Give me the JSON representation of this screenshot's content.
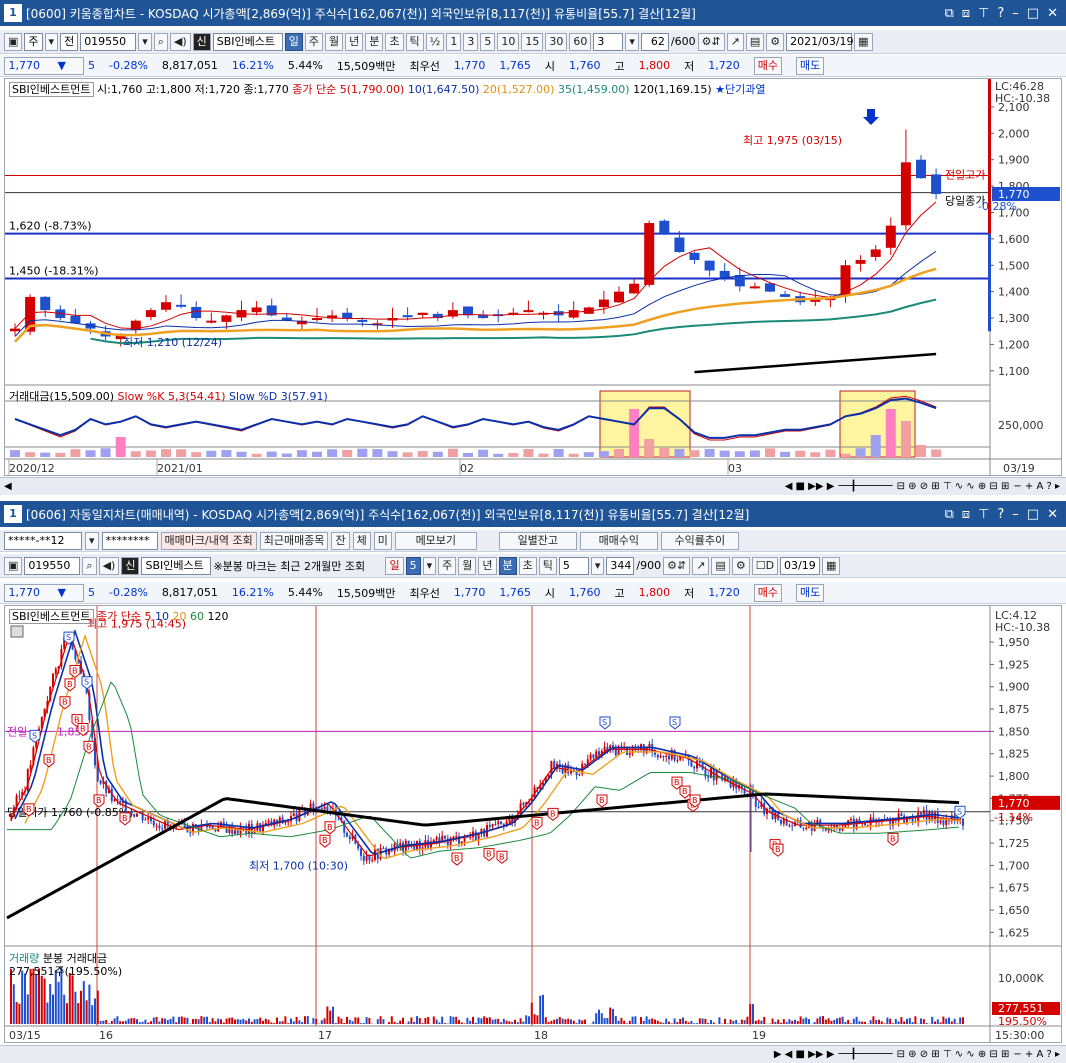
{
  "top": {
    "title_num": "1",
    "title": "[0600] 키움종합차트 - KOSDAQ 시가총액[2,869(억)] 주식수[162,067(천)] 외국인보유[8,117(천)] 유통비율[55.7] 결산[12월]",
    "toolbar": {
      "type_sel": "주",
      "type2": "전",
      "code": "019550",
      "name_badge": "신",
      "name": "SBI인베스트",
      "periods": [
        "일",
        "주",
        "월",
        "년",
        "분",
        "초",
        "틱"
      ],
      "active_period": "일",
      "frac": "½",
      "mins": [
        "1",
        "3",
        "5",
        "10",
        "15",
        "30",
        "60"
      ],
      "min_val": "3",
      "count": "62",
      "count_total": "/600",
      "date": "2021/03/19"
    },
    "quote": {
      "price": "1,770",
      "arrow": "▼",
      "change": "5",
      "pct": "-0.28%",
      "volume": "8,817,051",
      "vol_pct": "16.21%",
      "turnover": "5.44%",
      "amount": "15,509백만",
      "best_ask_label": "최우선",
      "ask": "1,770",
      "bid": "1,765",
      "open_label": "시",
      "open": "1,760",
      "high_label": "고",
      "high": "1,800",
      "low_label": "저",
      "low": "1,720",
      "buy": "매수",
      "sell": "매도"
    },
    "price_legend": {
      "name": "SBI인베스트먼트",
      "ohlc": "시:1,760 고:1,800 저:1,720 종:1,770",
      "ma_label": "종가 단순",
      "ma5": "5(1,790.00)",
      "ma10": "10(1,647.50)",
      "ma20": "20(1,527.00)",
      "ma35": "35(1,459.00)",
      "ma120": "120(1,169.15)",
      "star": "★단기과열"
    },
    "lc": "LC:46.28",
    "hc": "HC:-10.38",
    "price_ticks": [
      "2,100",
      "2,000",
      "1,900",
      "1,800",
      "1,700",
      "1,600",
      "1,500",
      "1,400",
      "1,300",
      "1,200",
      "1,100"
    ],
    "current_price_tag": "1,770",
    "current_pct_tag": "-0.28%",
    "hline1": "1,620 (-8.73%)",
    "hline2": "1,450 (-18.31%)",
    "max_label": "최고 1,975 (03/15)",
    "min_label": "최저 1,210 (12/24)",
    "prev_high": "전일고가",
    "today_close": "당일종가",
    "ind_legend": {
      "a": "거래대금(15,509.00)",
      "b": "Slow %K 5,3(54.41)",
      "c": "Slow %D 3(57.91)"
    },
    "ind_tick": "250,000",
    "xlabels": [
      "2020/12",
      "2021/01",
      "02",
      "03"
    ],
    "xlabel_right": "03/19"
  },
  "bottom": {
    "title_num": "1",
    "title": "[0606] 자동일지차트(매매내역) - KOSDAQ 시가총액[2,869(억)] 주식수[162,067(천)] 외국인보유[8,117(천)] 유통비율[55.7] 결산[12월]",
    "toolbar1": {
      "account": "*****-**12",
      "password": "********",
      "b1": "매매마크/내역 조회",
      "b2": "최근매매종목",
      "b3": "잔",
      "b4": "체",
      "b5": "미",
      "b6": "메모보기",
      "b7": "일별잔고",
      "b8": "매매수익",
      "b9": "수익률추이"
    },
    "toolbar2": {
      "code": "019550",
      "name_badge": "신",
      "name": "SBI인베스트",
      "notice": "※분봉 마크는 최근 2개월만 조회",
      "day": "일",
      "day_val": "5",
      "periods": [
        "주",
        "월",
        "년",
        "분",
        "초",
        "틱"
      ],
      "active": "분",
      "min_val": "5",
      "count": "344",
      "count_total": "/900",
      "chk": "D",
      "date": "03/19"
    },
    "quote": {
      "price": "1,770",
      "arrow": "▼",
      "change": "5",
      "pct": "-0.28%",
      "volume": "8,817,051",
      "vol_pct": "16.21%",
      "turnover": "5.44%",
      "amount": "15,509백만",
      "best_ask_label": "최우선",
      "ask": "1,770",
      "bid": "1,765",
      "open_label": "시",
      "open": "1,760",
      "high_label": "고",
      "high": "1,800",
      "low_label": "저",
      "low": "1,720",
      "buy": "매수",
      "sell": "매도"
    },
    "price_legend": {
      "name": "SBI인베스트먼트",
      "ma_label": "종가 단순",
      "m5": "5",
      "m10": "10",
      "m20": "20",
      "m60": "60",
      "m120": "120"
    },
    "lc": "LC:4.12",
    "hc": "HC:-10.38",
    "price_ticks": [
      "1,950",
      "1,925",
      "1,900",
      "1,875",
      "1,850",
      "1,825",
      "1,800",
      "1,775",
      "1,750",
      "1,725",
      "1,700",
      "1,675",
      "1,650",
      "1,625"
    ],
    "current_price_tag": "1,770",
    "current_pct_tag": "-1.14%",
    "max_label": "최고 1,975 (14:45)",
    "min_label": "최저 1,700 (10:30)",
    "prev_label": "전일",
    "prev_val": "1,850",
    "open_label": "당일시가 1,760 (-0.85%)",
    "vol_legend1": "거래량",
    "vol_legend2": "분봉 거래대금",
    "vol_value": "277,551주(195.50%)",
    "vol_tick": "10,000K",
    "vol_tag1": "277,551",
    "vol_tag2": "195.50%",
    "xlabels": [
      "03/15",
      "16",
      "17",
      "18",
      "19"
    ],
    "xlabel_right": "15:30:00"
  },
  "colors": {
    "up": "#d40000",
    "down": "#1d4fcf",
    "title_bg": "#1f5597",
    "ma5": "#d40000",
    "ma10": "#0b2fa8",
    "ma20": "#f0a020",
    "ma35": "#1a8a7a",
    "ma120": "#000000"
  }
}
